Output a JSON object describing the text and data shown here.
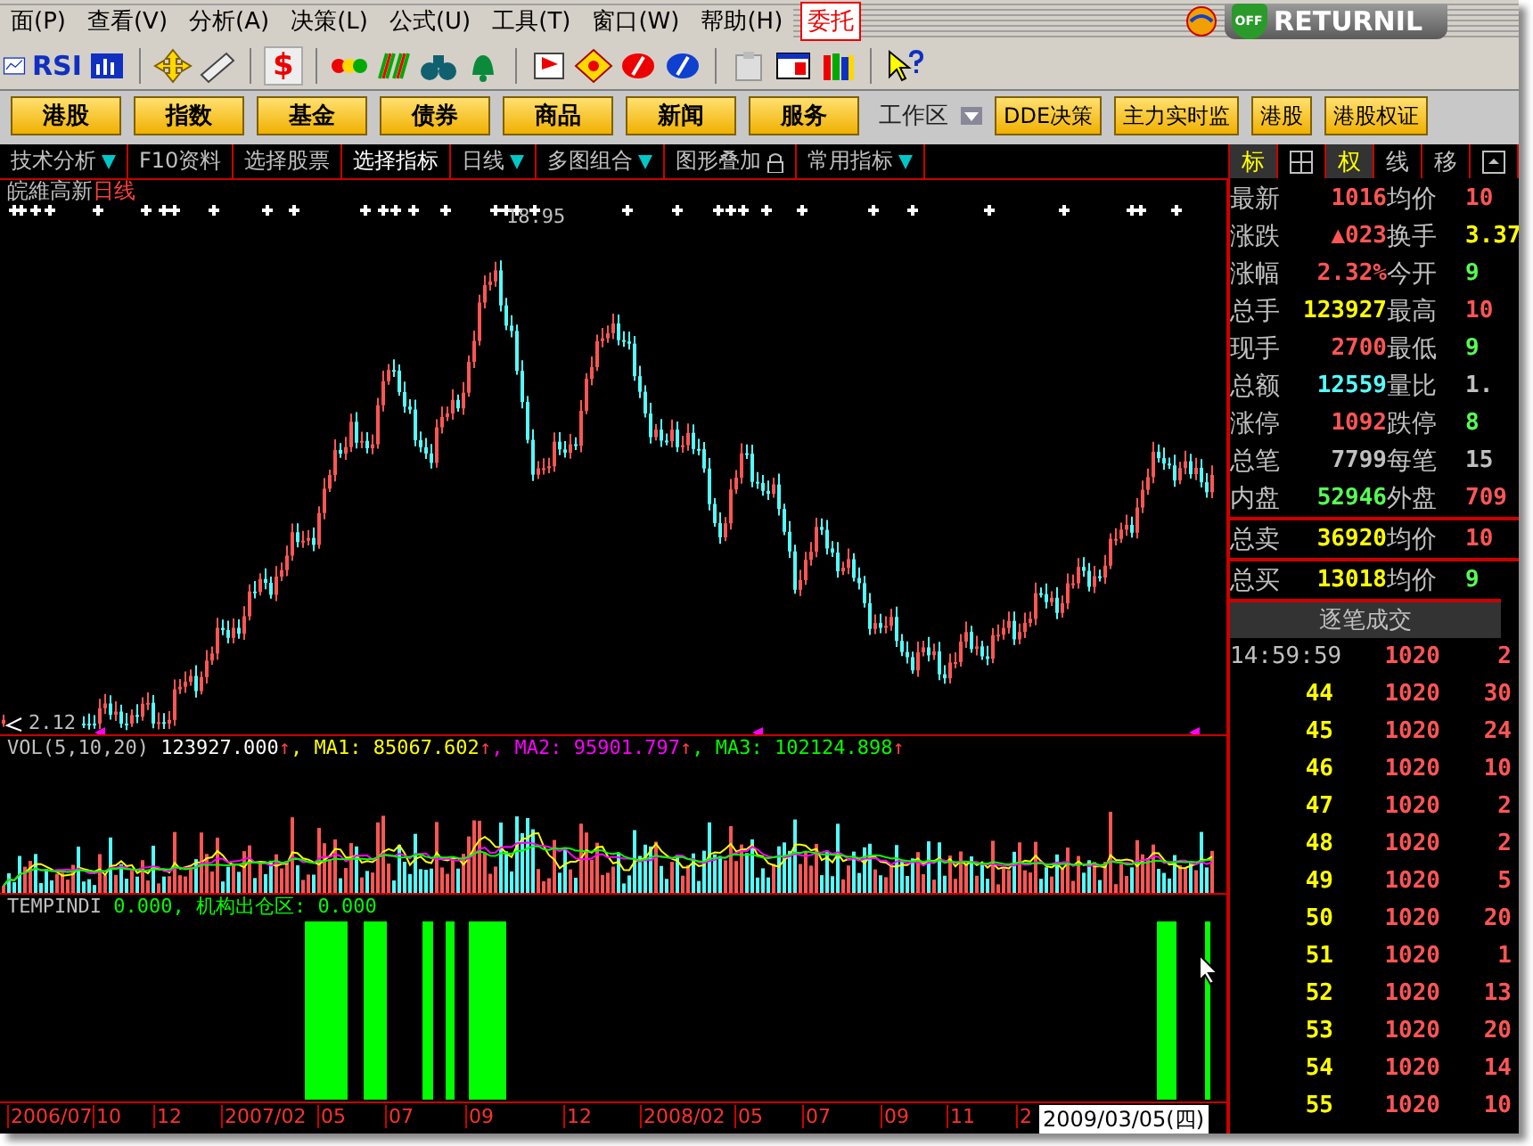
{
  "menu": {
    "items": [
      "面(P)",
      "查看(V)",
      "分析(A)",
      "决策(L)",
      "公式(U)",
      "工具(T)",
      "窗口(W)",
      "帮助(H)"
    ],
    "trade_button": "委托"
  },
  "returnil": {
    "label": "RETURNIL",
    "badge": "OFF"
  },
  "toolbar": {
    "rsi_label": "RSI",
    "dollar_label": "$"
  },
  "market_buttons": [
    "港股",
    "指数",
    "基金",
    "债券",
    "商品",
    "新闻",
    "服务"
  ],
  "workspace": {
    "label": "工作区",
    "buttons": [
      "DDE决策",
      "主力实时监",
      "港股",
      "港股权证"
    ]
  },
  "tabs": [
    {
      "label": "技术分析",
      "dropdown": true,
      "selected": false
    },
    {
      "label": "F10资料",
      "dropdown": false,
      "selected": false
    },
    {
      "label": "选择股票",
      "dropdown": false,
      "selected": false
    },
    {
      "label": "选择指标",
      "dropdown": false,
      "selected": true
    },
    {
      "label": "日线",
      "dropdown": true,
      "selected": false
    },
    {
      "label": "多图组合",
      "dropdown": true,
      "selected": false
    },
    {
      "label": "图形叠加",
      "dropdown": false,
      "selected": false,
      "lock": true
    },
    {
      "label": "常用指标",
      "dropdown": true,
      "selected": false
    }
  ],
  "side_tabs": [
    {
      "kind": "text",
      "label": "标",
      "selected": true
    },
    {
      "kind": "grid",
      "selected": false
    },
    {
      "kind": "text",
      "label": "权",
      "selected": true
    },
    {
      "kind": "text",
      "label": "线",
      "selected": false
    },
    {
      "kind": "text",
      "label": "移",
      "selected": false
    },
    {
      "kind": "panel",
      "selected": false
    }
  ],
  "chart": {
    "stock": "皖維高新",
    "period": "日线",
    "high_label": "18.95",
    "low_label": "2.12",
    "vol_legend": [
      {
        "text": "VOL(5,10,20)",
        "color": "#c0c0c0"
      },
      {
        "text": "123927.000",
        "color": "#ffffff",
        "arrow": "↑"
      },
      {
        "text": ", MA1: 85067.602",
        "color": "#ffff00",
        "arrow": "↑"
      },
      {
        "text": ", MA2: 95901.797",
        "color": "#ff00ff",
        "arrow": "↑"
      },
      {
        "text": ", MA3: 102124.898",
        "color": "#00ff00",
        "arrow": "↑"
      }
    ],
    "indicator_name": "TEMPINDI",
    "indicator_values": "0.000, 机构出仓区: 0.000",
    "dates": [
      "2006/07",
      "10",
      "12",
      "2007/02",
      "05",
      "07",
      "09",
      "12",
      "2008/02",
      "05",
      "07",
      "09",
      "11",
      "2"
    ],
    "current_date": "2009/03/05(四)"
  },
  "quote": [
    {
      "cells": [
        {
          "label": "最新",
          "value": "1016",
          "color": "#ff5555"
        },
        {
          "label": "均价",
          "value": "10",
          "color": "#ff5555"
        }
      ]
    },
    {
      "cells": [
        {
          "label": "涨跌",
          "value": "▲023",
          "color": "#ff5555"
        },
        {
          "label": "换手",
          "value": "3.37",
          "color": "#ffff00"
        }
      ]
    },
    {
      "cells": [
        {
          "label": "涨幅",
          "value": "2.32%",
          "color": "#ff5555"
        },
        {
          "label": "今开",
          "value": "9",
          "color": "#55ff55"
        }
      ]
    },
    {
      "cells": [
        {
          "label": "总手",
          "value": "123927",
          "color": "#ffff00"
        },
        {
          "label": "最高",
          "value": "10",
          "color": "#ff5555"
        }
      ]
    },
    {
      "cells": [
        {
          "label": "现手",
          "value": "2700",
          "color": "#ff5555"
        },
        {
          "label": "最低",
          "value": "9",
          "color": "#55ff55"
        }
      ]
    },
    {
      "cells": [
        {
          "label": "总额",
          "value": "12559",
          "color": "#55ffff"
        },
        {
          "label": "量比",
          "value": "1.",
          "color": "#c0c0c0"
        }
      ]
    },
    {
      "cells": [
        {
          "label": "涨停",
          "value": "1092",
          "color": "#ff5555"
        },
        {
          "label": "跌停",
          "value": "8",
          "color": "#55ff55"
        }
      ]
    },
    {
      "cells": [
        {
          "label": "总笔",
          "value": "7799",
          "color": "#c0c0c0"
        },
        {
          "label": "每笔",
          "value": "15",
          "color": "#c0c0c0"
        }
      ]
    },
    {
      "cells": [
        {
          "label": "内盘",
          "value": "52946",
          "color": "#55ff55"
        },
        {
          "label": "外盘",
          "value": "709",
          "color": "#ff5555"
        }
      ]
    },
    {
      "cells": [
        {
          "label": "总卖",
          "value": "36920",
          "color": "#ffff00"
        },
        {
          "label": "均价",
          "value": "10",
          "color": "#ff5555"
        }
      ]
    },
    {
      "cells": [
        {
          "label": "总买",
          "value": "13018",
          "color": "#ffff00"
        },
        {
          "label": "均价",
          "value": "9",
          "color": "#55ff55"
        }
      ]
    }
  ],
  "ticks_title": "逐笔成交",
  "ticks": [
    {
      "time": "14:59:59",
      "price": "1020",
      "volume": "2"
    },
    {
      "time": "44",
      "price": "1020",
      "volume": "30"
    },
    {
      "time": "45",
      "price": "1020",
      "volume": "24"
    },
    {
      "time": "46",
      "price": "1020",
      "volume": "10"
    },
    {
      "time": "47",
      "price": "1020",
      "volume": "2"
    },
    {
      "time": "48",
      "price": "1020",
      "volume": "2"
    },
    {
      "time": "49",
      "price": "1020",
      "volume": "5"
    },
    {
      "time": "50",
      "price": "1020",
      "volume": "20"
    },
    {
      "time": "51",
      "price": "1020",
      "volume": "1"
    },
    {
      "time": "52",
      "price": "1020",
      "volume": "13"
    },
    {
      "time": "53",
      "price": "1020",
      "volume": "20"
    },
    {
      "time": "54",
      "price": "1020",
      "volume": "14"
    },
    {
      "time": "55",
      "price": "1020",
      "volume": "10"
    }
  ]
}
